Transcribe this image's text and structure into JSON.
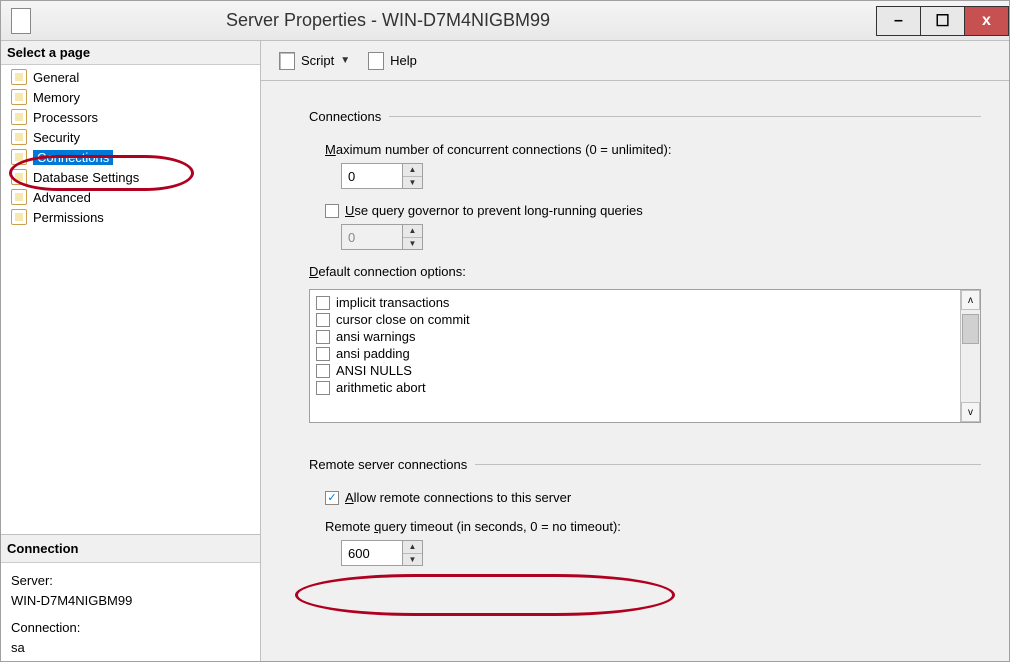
{
  "window": {
    "title": "Server Properties - WIN-D7M4NIGBM99"
  },
  "winbtns": {
    "min": "–",
    "max": "☐",
    "close": "x"
  },
  "sidebar": {
    "select_page": "Select a page",
    "items": [
      {
        "label": "General"
      },
      {
        "label": "Memory"
      },
      {
        "label": "Processors"
      },
      {
        "label": "Security"
      },
      {
        "label": "Connections",
        "selected": true
      },
      {
        "label": "Database Settings"
      },
      {
        "label": "Advanced"
      },
      {
        "label": "Permissions"
      }
    ],
    "connection_hdr": "Connection",
    "server_label": "Server:",
    "server_value": "WIN-D7M4NIGBM99",
    "conn_label": "Connection:",
    "conn_value": "sa"
  },
  "toolbar": {
    "script": "Script",
    "help": "Help"
  },
  "main": {
    "connections_group": "Connections",
    "max_conn_label_pre": "M",
    "max_conn_label_post": "aximum number of concurrent connections (0 = unlimited):",
    "max_conn_value": "0",
    "use_governor_pre": "U",
    "use_governor_post": "se query governor to prevent long-running queries",
    "governor_value": "0",
    "default_opts_pre": "D",
    "default_opts_post": "efault connection options:",
    "options": [
      "implicit transactions",
      "cursor close on commit",
      "ansi warnings",
      "ansi padding",
      "ANSI NULLS",
      "arithmetic abort"
    ],
    "remote_group": "Remote server connections",
    "allow_remote_pre": "A",
    "allow_remote_post": "llow remote connections to this server",
    "allow_remote_checked": "✓",
    "remote_timeout_pre": "Remote ",
    "remote_timeout_u": "q",
    "remote_timeout_post": "uery timeout (in seconds, 0 = no timeout):",
    "remote_timeout_value": "600"
  }
}
